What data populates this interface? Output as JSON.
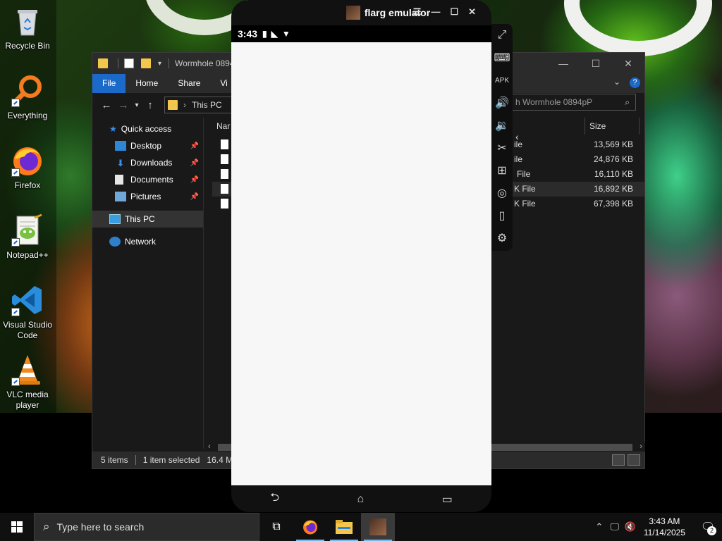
{
  "desktop": {
    "icons": [
      {
        "label": "Recycle Bin",
        "icon": "recycle-bin-icon"
      },
      {
        "label": "Everything",
        "icon": "everything-search-icon"
      },
      {
        "label": "Firefox",
        "icon": "firefox-icon"
      },
      {
        "label": "Notepad++",
        "icon": "notepadpp-icon"
      },
      {
        "label": "Visual Studio Code",
        "icon": "vscode-icon"
      },
      {
        "label": "VLC media player",
        "icon": "vlc-icon"
      }
    ]
  },
  "explorer": {
    "title": "Wormhole 0894p",
    "tabs": [
      "File",
      "Home",
      "Share",
      "Vi"
    ],
    "breadcrumb": "This PC",
    "search_placeholder": "h Wormhole 0894pP",
    "nav": {
      "quick_access": "Quick access",
      "pinned": [
        "Desktop",
        "Downloads",
        "Documents",
        "Pictures"
      ],
      "this_pc": "This PC",
      "network": "Network"
    },
    "columns": {
      "name": "Nar",
      "size": "Size"
    },
    "files": [
      {
        "type": "ile",
        "size": "13,569 KB"
      },
      {
        "type": "ile",
        "size": "24,876 KB"
      },
      {
        "type": "File",
        "size": "16,110 KB"
      },
      {
        "type": "K File",
        "size": "16,892 KB"
      },
      {
        "type": "K File",
        "size": "67,398 KB"
      }
    ],
    "status": {
      "items": "5 items",
      "selected": "1 item selected",
      "size": "16.4 MB"
    }
  },
  "emulator": {
    "title": "flarg emulator",
    "time": "3:43"
  },
  "taskbar": {
    "search_placeholder": "Type here to search",
    "time": "3:43 AM",
    "date": "11/14/2025",
    "notifications": "2"
  }
}
